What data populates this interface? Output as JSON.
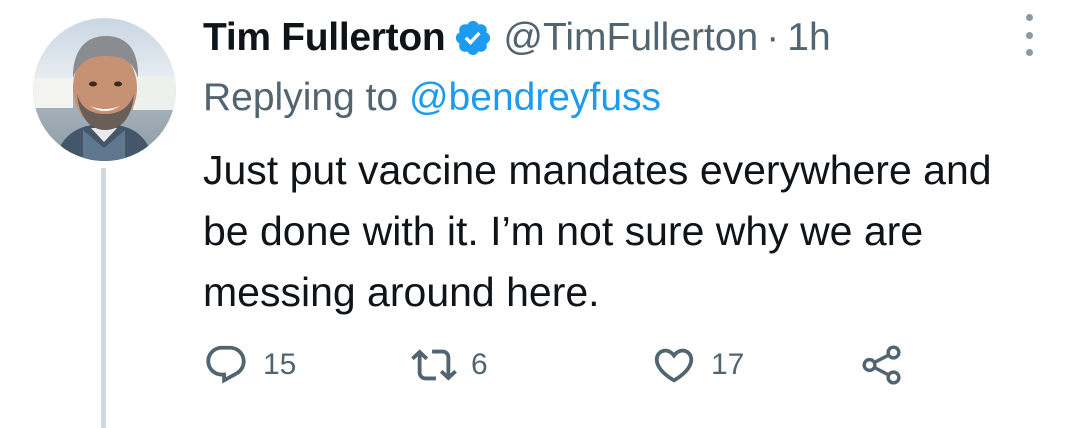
{
  "tweet": {
    "author_name": "Tim Fullerton",
    "handle": "@TimFullerton",
    "separator": "·",
    "time": "1h",
    "verified": true,
    "reply_prefix": "Replying to",
    "reply_mention": "@bendreyfuss",
    "text": "Just put vaccine mandates everywhere and be done with it. I’m not sure why we are messing around here."
  },
  "actions": {
    "reply_count": "15",
    "retweet_count": "6",
    "like_count": "17"
  },
  "icons": {
    "verified": "verified-badge-icon",
    "more": "more-vertical-icon",
    "reply": "reply-icon",
    "retweet": "retweet-icon",
    "like": "heart-icon",
    "share": "share-icon"
  },
  "colors": {
    "text": "#0f1419",
    "secondary": "#536471",
    "link": "#1d9bf0",
    "verified": "#1d9bf0",
    "thread_line": "#cfd9de"
  }
}
